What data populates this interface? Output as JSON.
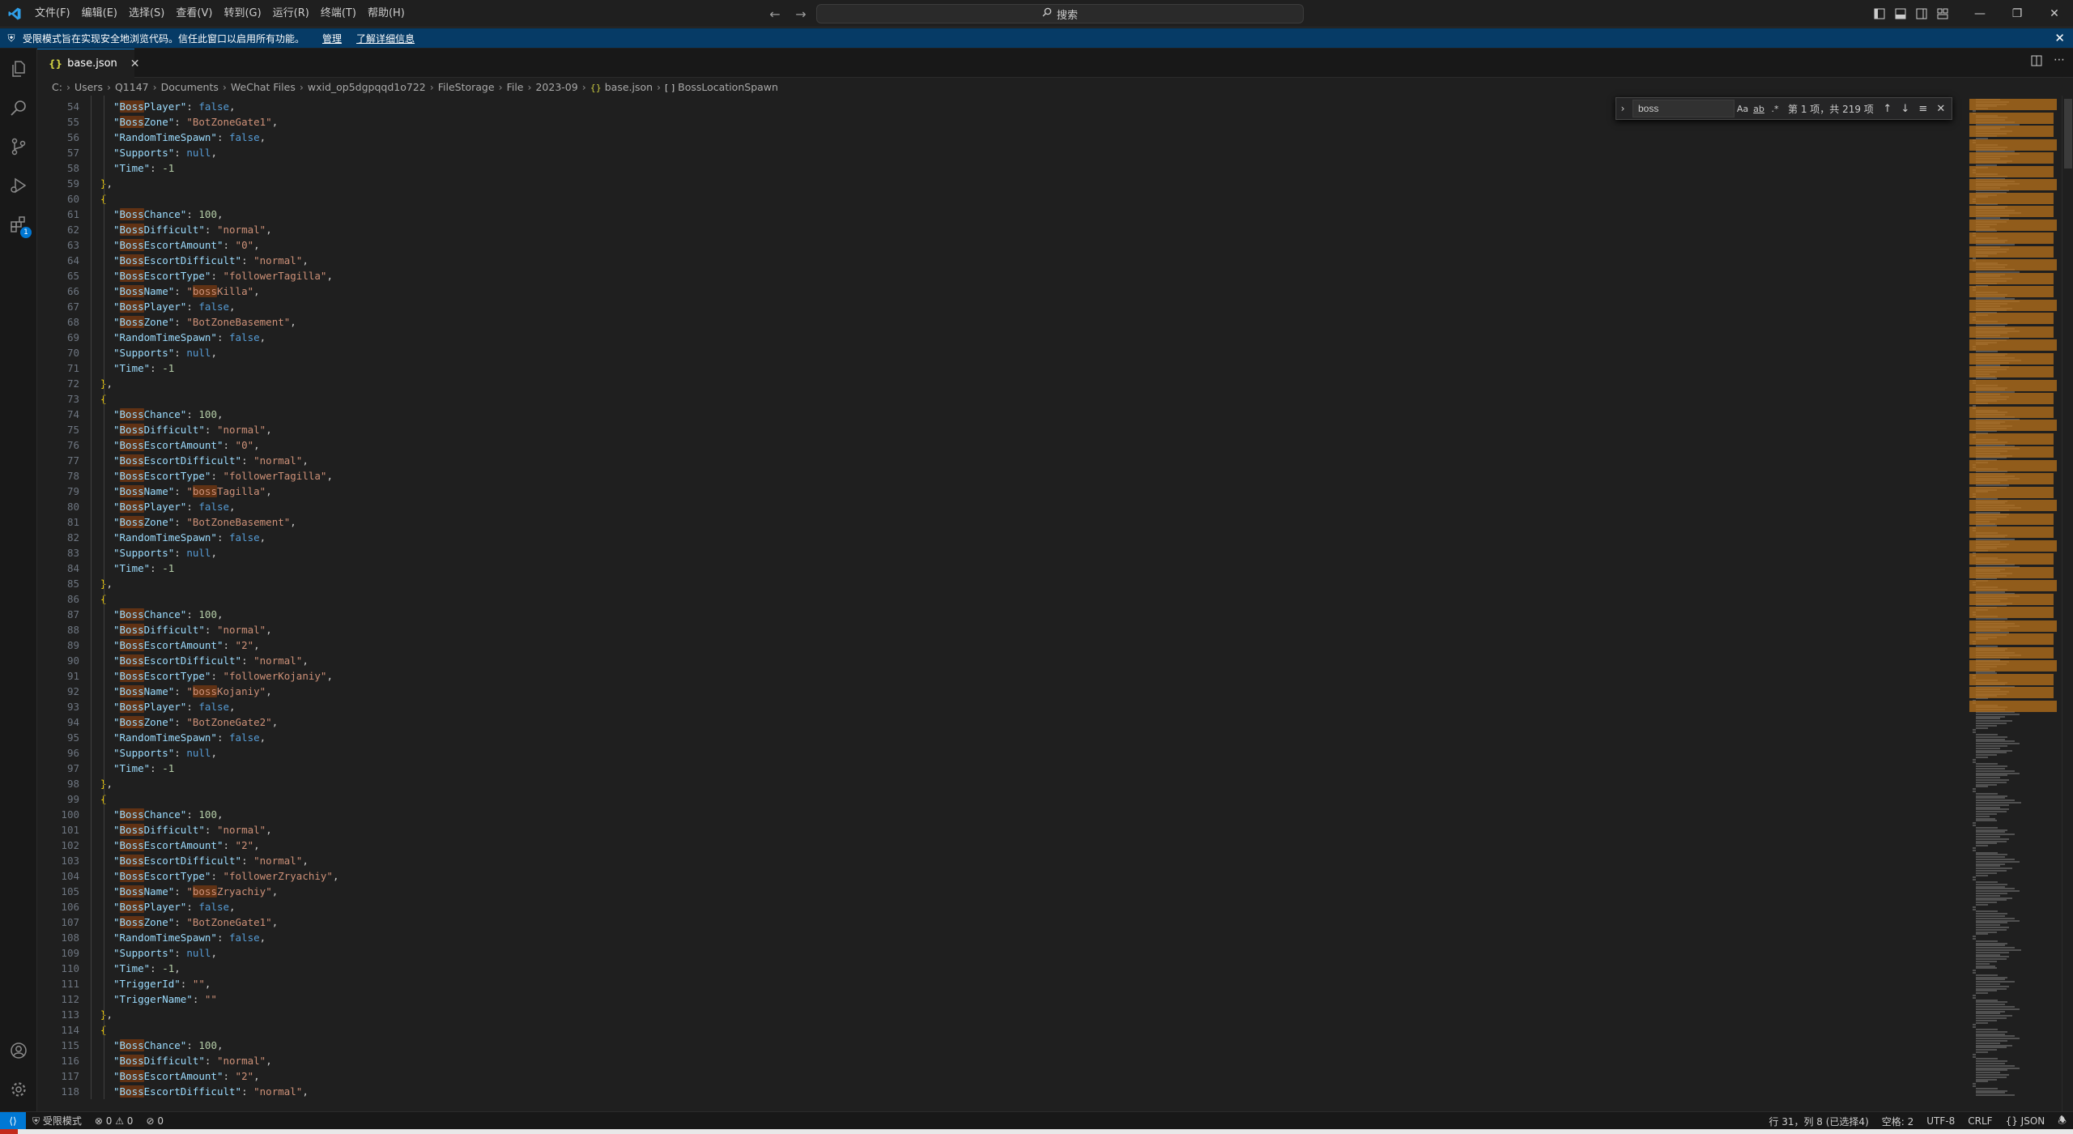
{
  "window": {
    "menu": [
      "文件(F)",
      "编辑(E)",
      "选择(S)",
      "查看(V)",
      "转到(G)",
      "运行(R)",
      "终端(T)",
      "帮助(H)"
    ],
    "search_label": "搜索"
  },
  "banner": {
    "message": "受限模式旨在实现安全地浏览代码。信任此窗口以启用所有功能。",
    "manage": "管理",
    "learn_more": "了解详细信息"
  },
  "tab": {
    "name": "base.json"
  },
  "breadcrumb": [
    "C:",
    "Users",
    "Q1147",
    "Documents",
    "WeChat Files",
    "wxid_op5dgpqqd1o722",
    "FileStorage",
    "File",
    "2023-09",
    "base.json",
    "BossLocationSpawn"
  ],
  "editor": {
    "first_line": 54,
    "lines": [
      "\"BossPlayer\": false,",
      "\"BossZone\": \"BotZoneGate1\",",
      "\"RandomTimeSpawn\": false,",
      "\"Supports\": null,",
      "\"Time\": -1",
      "},",
      "{",
      "\"BossChance\": 100,",
      "\"BossDifficult\": \"normal\",",
      "\"BossEscortAmount\": \"0\",",
      "\"BossEscortDifficult\": \"normal\",",
      "\"BossEscortType\": \"followerTagilla\",",
      "\"BossName\": \"bossKilla\",",
      "\"BossPlayer\": false,",
      "\"BossZone\": \"BotZoneBasement\",",
      "\"RandomTimeSpawn\": false,",
      "\"Supports\": null,",
      "\"Time\": -1",
      "},",
      "{",
      "\"BossChance\": 100,",
      "\"BossDifficult\": \"normal\",",
      "\"BossEscortAmount\": \"0\",",
      "\"BossEscortDifficult\": \"normal\",",
      "\"BossEscortType\": \"followerTagilla\",",
      "\"BossName\": \"bossTagilla\",",
      "\"BossPlayer\": false,",
      "\"BossZone\": \"BotZoneBasement\",",
      "\"RandomTimeSpawn\": false,",
      "\"Supports\": null,",
      "\"Time\": -1",
      "},",
      "{",
      "\"BossChance\": 100,",
      "\"BossDifficult\": \"normal\",",
      "\"BossEscortAmount\": \"2\",",
      "\"BossEscortDifficult\": \"normal\",",
      "\"BossEscortType\": \"followerKojaniy\",",
      "\"BossName\": \"bossKojaniy\",",
      "\"BossPlayer\": false,",
      "\"BossZone\": \"BotZoneGate2\",",
      "\"RandomTimeSpawn\": false,",
      "\"Supports\": null,",
      "\"Time\": -1",
      "},",
      "{",
      "\"BossChance\": 100,",
      "\"BossDifficult\": \"normal\",",
      "\"BossEscortAmount\": \"2\",",
      "\"BossEscortDifficult\": \"normal\",",
      "\"BossEscortType\": \"followerZryachiy\",",
      "\"BossName\": \"bossZryachiy\",",
      "\"BossPlayer\": false,",
      "\"BossZone\": \"BotZoneGate1\",",
      "\"RandomTimeSpawn\": false,",
      "\"Supports\": null,",
      "\"Time\": -1,",
      "\"TriggerId\": \"\",",
      "\"TriggerName\": \"\"",
      "},",
      "{",
      "\"BossChance\": 100,",
      "\"BossDifficult\": \"normal\",",
      "\"BossEscortAmount\": \"2\",",
      "\"BossEscortDifficult\": \"normal\","
    ]
  },
  "find": {
    "query": "boss",
    "result": "第 1 项，共 219 项"
  },
  "status": {
    "restricted": "受限模式",
    "errors": "0",
    "warnings": "0",
    "ports": "0",
    "position": "行 31，列 8 (已选择4)",
    "spaces": "空格: 2",
    "encoding": "UTF-8",
    "eol": "CRLF",
    "language": "JSON"
  },
  "colors": {
    "accent": "#0078d4",
    "banner": "#063b66",
    "match": "#ea5c00"
  }
}
